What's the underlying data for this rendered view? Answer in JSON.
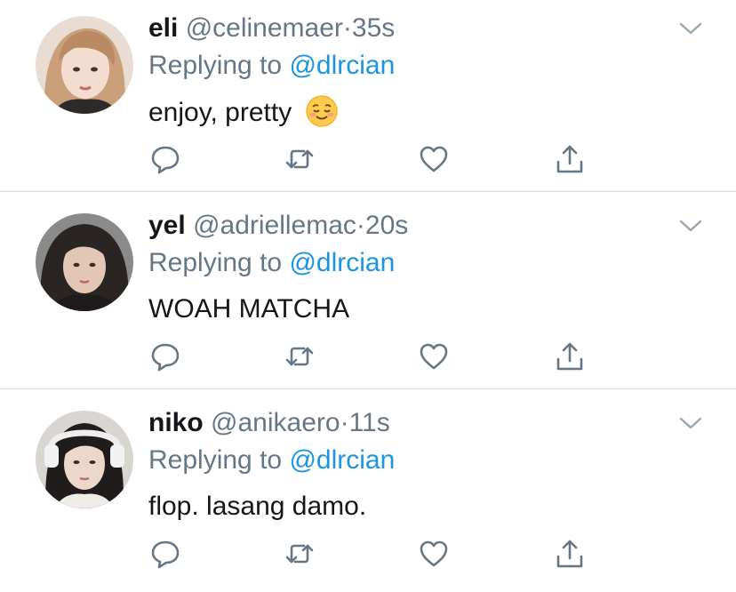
{
  "colors": {
    "text_primary": "#14171a",
    "text_secondary": "#657786",
    "link": "#1b95e0",
    "divider": "#d7dbdf",
    "icon": "#657786"
  },
  "replying_prefix": "Replying to",
  "tweets": [
    {
      "name": "eli",
      "handle": "@celinemaer",
      "separator": "·",
      "time": "35s",
      "replying_to": "@dlrcian",
      "text": "enjoy, pretty",
      "emoji": "smiling-face-icon"
    },
    {
      "name": "yel",
      "handle": "@adriellemac",
      "separator": "·",
      "time": "20s",
      "replying_to": "@dlrcian",
      "text": "WOAH MATCHA"
    },
    {
      "name": "niko",
      "handle": "@anikaero",
      "separator": "·",
      "time": "11s",
      "replying_to": "@dlrcian",
      "text": "flop. lasang damo."
    }
  ],
  "icons": {
    "reply": "reply-icon",
    "retweet": "retweet-icon",
    "like": "heart-icon",
    "share": "share-icon",
    "more": "chevron-down-icon"
  }
}
